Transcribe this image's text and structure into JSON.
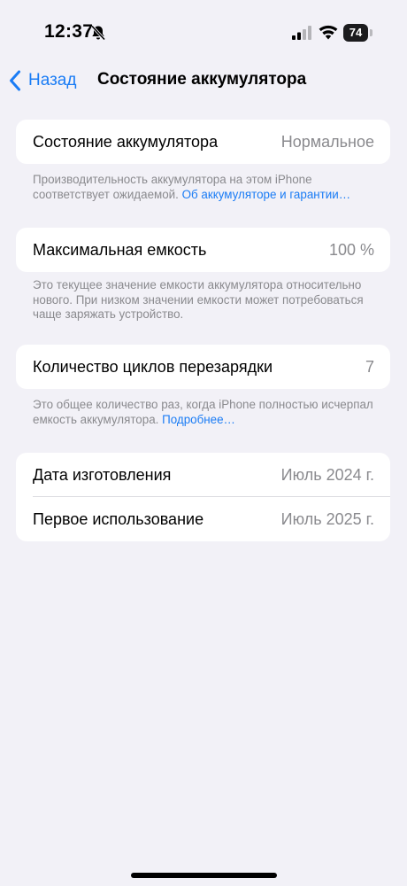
{
  "status_bar": {
    "time": "12:37",
    "battery_level": "74"
  },
  "nav": {
    "back_label": "Назад",
    "title": "Состояние аккумулятора"
  },
  "sections": {
    "health": {
      "label": "Состояние аккумулятора",
      "value": "Нормальное",
      "footnote_text": "Производительность аккумулятора на этом iPhone соответствует ожидаемой.",
      "footnote_link": "Об аккумуляторе и гарантии…"
    },
    "capacity": {
      "label": "Максимальная емкость",
      "value": "100 %",
      "footnote_text": "Это текущее значение емкости аккумулятора относительно нового. При низком значении емкости может потребоваться чаще заряжать устройство."
    },
    "cycles": {
      "label": "Количество циклов перезарядки",
      "value": "7",
      "footnote_text": "Это общее количество раз, когда iPhone полностью исчерпал емкость аккумулятора.",
      "footnote_link": "Подробнее…"
    },
    "dates": {
      "manufacture_label": "Дата изготовления",
      "manufacture_value": "Июль 2024 г.",
      "first_use_label": "Первое использование",
      "first_use_value": "Июль 2025 г."
    }
  },
  "colors": {
    "accent": "#1a7cf5",
    "background": "#f2f1f7",
    "secondary_text": "#8a8a8e"
  },
  "icons": [
    "bell-slash-icon",
    "cellular-signal-icon",
    "wifi-icon",
    "battery-icon",
    "chevron-left-icon"
  ]
}
